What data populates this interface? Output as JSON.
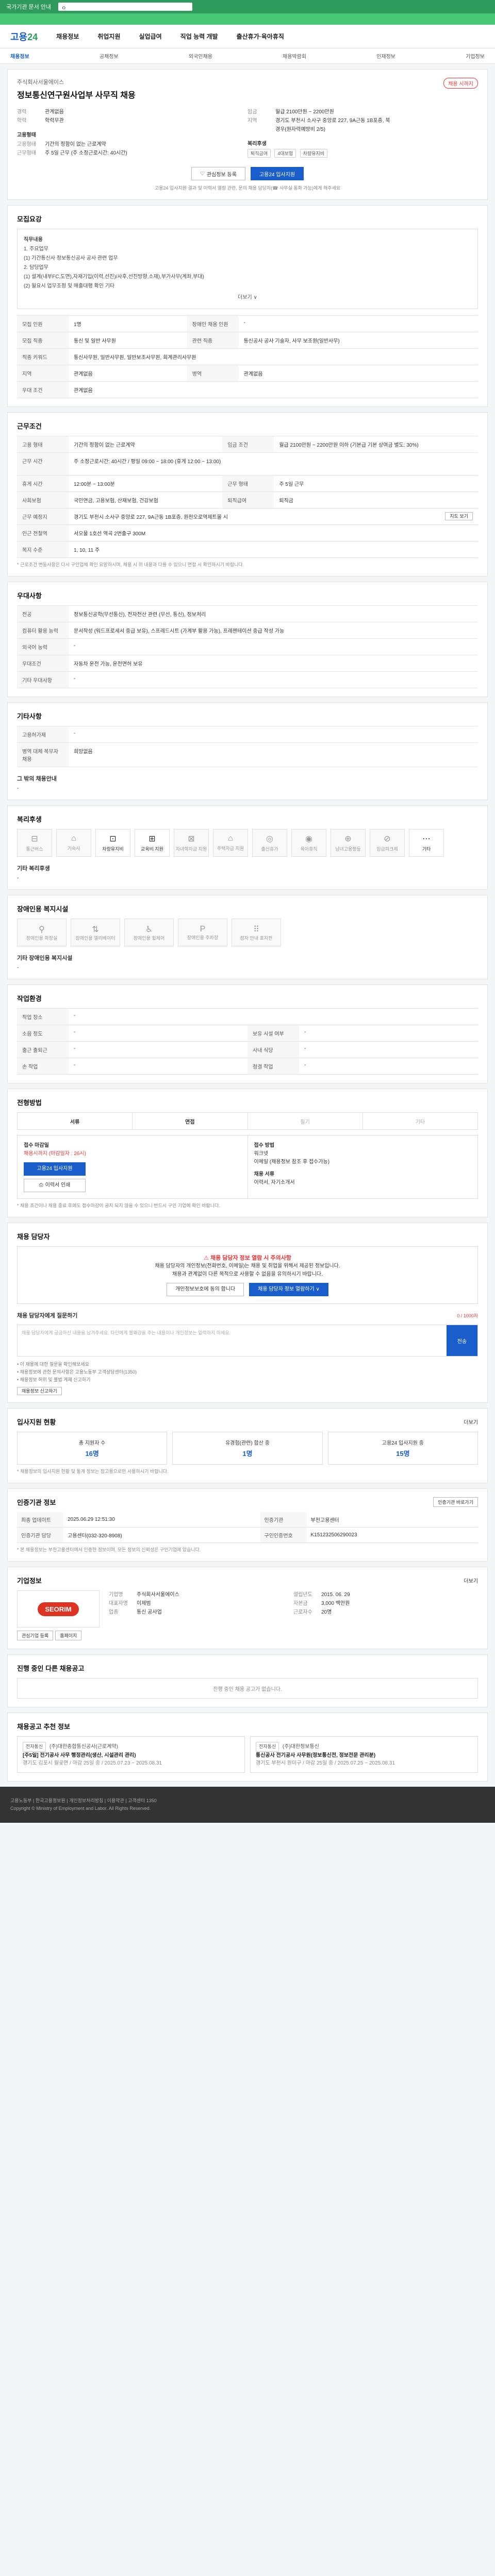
{
  "topbar": {
    "title": "국가기관 문서 안내",
    "search": "ㅇ"
  },
  "greenline": "",
  "gnb": {
    "logo_main": "고용",
    "logo_num": "24",
    "items": [
      "채용정보",
      "취업지원",
      "실업급여",
      "직업 능력 개발",
      "출산휴가·육아휴직"
    ]
  },
  "subnav": [
    "채용정보",
    "공채정보",
    "외국인채용",
    "채용박람회",
    "인재정보",
    "기업정보"
  ],
  "job": {
    "company": "주식회사서울에이스",
    "title": "정보통신연구원사업부 사무직 채용",
    "badge": "채용 시까지",
    "left": [
      {
        "k": "경력",
        "v": "관계없음"
      },
      {
        "k": "학력",
        "v": "학력무관"
      }
    ],
    "right": [
      {
        "k": "임금",
        "v": "월급 2100만원 ~ 2200만원"
      },
      {
        "k": "지역",
        "v": "경기도 부천시 소사구 중앙로 227, 9A근동 1B포층, 북"
      },
      {
        "k": "",
        "v": "경우(원자력예방비 2/5)"
      }
    ],
    "employ_title": "고용형태",
    "employ": [
      {
        "k": "고용형태",
        "v": "기간의 정함이 없는 근로계약"
      },
      {
        "k": "근무형태",
        "v": "주 5일 근무 (주 소정근로시간: 40시간)"
      }
    ],
    "welfare_title": "복리후생",
    "tags": [
      "퇴직금여",
      "4대보험",
      "차량유지비"
    ],
    "btn_save": "관심정보 등록",
    "btn_apply": "고용24 입사지원",
    "note": "고용24 입사지원 결과 및 이력서 열람 관련, 문의 채용 담당자(☎ 사무실 통화 가능)에게 해주세요"
  },
  "recruit": {
    "title": "모집요강",
    "box_lines": [
      "직무내용",
      "1. 주요업무",
      "(1) 기간통신사 정보통신공사 공사 관련 업무",
      "2. 담당업무",
      "(1) 설계(내부FC,도면),자재기입(이력,선진)/사후,선진방향,소재),부가사무(계좌,부대)",
      "(2) 월요시 업무조정 및 매출대행 확인 기타"
    ],
    "more": "더보기 ∨",
    "rows": [
      {
        "h": "모집 인원",
        "v": "1명",
        "h2": "장애인 채용 인원",
        "v2": "-"
      },
      {
        "h": "모집 직종",
        "v": "통신 및 일반 사무원",
        "h2": "관련 직종",
        "v2": "통신공사 공사 기술자, 사무 보조원(일반사무)"
      },
      {
        "h": "직종 키워드",
        "v": "통신사무원, 일반사무원, 일반보조사무원, 회계관리사무원",
        "h2": "",
        "v2": ""
      },
      {
        "h": "지역",
        "v": "관계없음",
        "h2": "병역",
        "v2": "관계없음"
      },
      {
        "h": "우대 조건",
        "v": "관계없음",
        "h2": "",
        "v2": ""
      }
    ]
  },
  "conditions": {
    "title": "근무조건",
    "rows": [
      {
        "h": "고용 형태",
        "v": "기간의 정함이 없는 근로계약",
        "h2": "임금 조건",
        "v2": "월급 2100만원 ~ 2200만원 이하 (기본급 기본 상여금 별도: 30%)"
      },
      {
        "h": "근무 시간",
        "v": "주 소정근로시간: 40시간 / 평일 09:00 ~ 18:00 (휴게 12:00 ~ 13:00)",
        "h2": "",
        "v2": ""
      },
      {
        "h": "휴게 시간",
        "v": "12:00분 ~ 13:00분",
        "h2": "근무 형태",
        "v2": "주 5일 근무"
      },
      {
        "h": "사회보험",
        "v": "국민연금, 고용보험, 산재보험, 건강보험",
        "h2": "퇴직급여",
        "v2": "퇴직금"
      },
      {
        "h": "근무 예정지",
        "v": "경기도 부천시 소사구 중앙로 227, 9A근동 1B포층, 원천오로역제트몰 시",
        "h2": "",
        "v2": ""
      },
      {
        "h": "인근 전철역",
        "v": "서오물 1호선 역곡 2번출구 300M",
        "h2": "",
        "v2": ""
      },
      {
        "h": "복지 수준",
        "v": "1, 10, 11 주",
        "h2": "",
        "v2": ""
      }
    ],
    "note": "* 근로조건 변동사항은 다시 구인업체 확인 요망하시며, 채용 시 위 내용과 다를 수 있으니 면접 시 확인하시기 바랍니다.",
    "btn_map": "지도 보기"
  },
  "prefer": {
    "title": "우대사항",
    "rows": [
      {
        "h": "전공",
        "v": "정보통신공학(무선통신), 전자전산 관련 (무선, 통신), 정보처리"
      },
      {
        "h": "컴퓨터 활용 능력",
        "v": "문서작성 (워드프로세서 중급 보유), 스프레드시트 (가계부 활용 가능), 프레젠테이션 중급 작성 가능"
      },
      {
        "h": "외국어 능력",
        "v": "-"
      },
      {
        "h": "우대조건",
        "v": "자동차 운전 가능, 운전면허 보유"
      },
      {
        "h": "기타 우대사항",
        "v": "-"
      }
    ]
  },
  "etc": {
    "title": "기타사항",
    "rows": [
      {
        "h": "고용허가제",
        "v": "-"
      },
      {
        "h": "병역 대체 복무자 채용",
        "v": "희망없음"
      }
    ],
    "sub": "그 밖의 채용안내",
    "sub_v": "-"
  },
  "welfare": {
    "title": "복리후생",
    "icons": [
      {
        "n": "통근버스",
        "on": false,
        "g": "⊟"
      },
      {
        "n": "기숙사",
        "on": false,
        "g": "⌂"
      },
      {
        "n": "차량유지비",
        "on": true,
        "g": "⊡"
      },
      {
        "n": "교육비 지원",
        "on": true,
        "g": "⊞"
      },
      {
        "n": "자녀학자금 지원",
        "on": false,
        "g": "⊠"
      },
      {
        "n": "주택자금 지원",
        "on": false,
        "g": "⌂"
      },
      {
        "n": "출산휴가",
        "on": false,
        "g": "◎"
      },
      {
        "n": "육아휴직",
        "on": false,
        "g": "◉"
      },
      {
        "n": "남녀고용평등",
        "on": false,
        "g": "⊕"
      },
      {
        "n": "임금피크제",
        "on": false,
        "g": "⊘"
      },
      {
        "n": "기타",
        "on": true,
        "g": "⋯"
      }
    ],
    "sub": "기타 복리후생",
    "sub_v": "-"
  },
  "disability": {
    "title": "장애인용 복지시설",
    "items": [
      "장애인용 화장실",
      "장애인용 엘리베이터",
      "장애인용 휠체어",
      "장애인용 주차장",
      "점자 안내 표지판"
    ],
    "sub": "기타 장애인용 복지시설",
    "sub_v": "-"
  },
  "workenv": {
    "title": "작업환경",
    "rows": [
      {
        "h": "작업 장소",
        "v": "-",
        "h2": "",
        "v2": ""
      },
      {
        "h": "소음 정도",
        "v": "-",
        "h2": "보유 시설 여부",
        "v2": "-"
      },
      {
        "h": "출근 출퇴근",
        "v": "-",
        "h2": "사내 식당",
        "v2": "-"
      },
      {
        "h": "손 작업",
        "v": "-",
        "h2": "청결 작업",
        "v2": "-"
      }
    ]
  },
  "process": {
    "title": "전형방법",
    "steps": [
      "서류",
      "면접",
      "필기",
      "기타"
    ],
    "on": [
      true,
      true,
      false,
      false
    ],
    "apply_col1_title": "접수 마감일",
    "apply_col1_v": "채용시까지 (마감일자 : 26시)",
    "apply_btn": "고용24 입사지원",
    "print_btn": "이력서 인쇄",
    "apply_col2_title": "접수 방법",
    "apply_col2_lines": [
      "워크넷",
      "이메일 (채용정보 참조 후 접수가능)",
      "채용 서류",
      "이력서, 자기소개서"
    ],
    "note": "* 채용 조건이나 채용 종료 후에도 접수마감이 공지 되지 않을 수 있으니 반드시 구인 기업에 확인 바랍니다."
  },
  "contact": {
    "title": "채용 담당자",
    "warn_title": "채용 담당자 정보 열람 시 주의사항",
    "warn_line1": "채용 담당자의 개인정보(전화번호, 이메일)는 채용 및 취업을 위해서 제공된 정보입니다.",
    "warn_line2": "채용과 관계없이 다른 목적으로 사용할 수 없음을 유의하시기 바랍니다.",
    "btn_agree": "개인정보보호에 동의 합니다",
    "btn_view": "채용 담당자 정보 열람하기 ∨",
    "qna_title": "채용 담당자에게 질문하기",
    "qna_count": "0 / 1000자",
    "qna_placeholder": "채용 담당자에게 궁금하신 내용을 남겨주세요. 타인에게 불쾌감을 주는 내용이나 개인정보는 입력하지 마세요.",
    "qna_btn": "전송",
    "notes": [
      "• 이 채용에 대한 질문을 확인해보세요",
      "• 채용정보에 관한 문의사항은 고용노동부 고객상담센터(1350)",
      "• 채용정보 허위 및 불법 게재 신고하기"
    ],
    "report_btn": "채용정보 신고하기"
  },
  "stats": {
    "title": "입사지원 현황",
    "more": "더보기",
    "items": [
      {
        "l": "총 지원자 수",
        "v": "16명"
      },
      {
        "l": "유경험(관련) 합산 중",
        "v": "1명"
      },
      {
        "l": "고용24 입사지원 중",
        "v": "15명"
      }
    ],
    "note": "* 채용정보의 입사지원 현황 및 통계 정보는 참고용으로만 사용하시기 바랍니다."
  },
  "posting": {
    "title": "인증기관 정보",
    "btn": "인증기관 바로가기",
    "rows": [
      {
        "h": "최종 업데이트",
        "v": "2025.06.29 12:51:30",
        "h2": "인증기관",
        "v2": "부천고용센터"
      },
      {
        "h": "인증기관 담당",
        "v": "고용센터(032-320-8908)",
        "h2": "구인인증번호",
        "v2": "K151232506290023"
      }
    ],
    "note": "* 본 채용정보는 부천고용센터에서 인증한 정보이며, 모든 정보의 신뢰성은 구인기업에 있습니다."
  },
  "corp": {
    "title": "기업정보",
    "more": "더보기",
    "logo": "SEORIM",
    "info": [
      {
        "k": "기업명",
        "v": "주식회사서울에이스"
      },
      {
        "k": "설립년도",
        "v": "2015. 06. 29"
      },
      {
        "k": "대표자명",
        "v": "이제범"
      },
      {
        "k": "자본금",
        "v": "3,000 백만원"
      },
      {
        "k": "업종",
        "v": "통신 공사업"
      },
      {
        "k": "근로자수",
        "v": "20명"
      }
    ],
    "btn_like": "관심기업 등록",
    "btn_home": "홈페이지"
  },
  "others": {
    "title": "진행 중인 다른 채용공고",
    "empty": "진행 중인 채용 공고가 없습니다."
  },
  "recommend": {
    "title": "채용공고 추천 정보",
    "cards": [
      {
        "badge": "전자통신",
        "n": "(주)대한종합통신공사(근로계약)",
        "t": "[주5일] 전기공사 사무 행정관리(생산, 시설관리 관리)",
        "d": "경기도 김포시 월곶면 / 마감 25일 중 / 2025.07.23 ~ 2025.08.31"
      },
      {
        "badge": "전자통신",
        "n": "(주)대한정보통신",
        "t": "통신공사 전기공사 사무원(정보통신전, 정보전문 관리분)",
        "d": "경기도 부천시 원미구 / 마감 25일 중 / 2025.07.25 ~ 2025.08.31"
      }
    ]
  },
  "footer": {
    "lines": [
      "고용노동부 | 한국고용정보원 | 개인정보처리방침 | 이용약관 | 고객센터 1350",
      "Copyright © Ministry of Employment and Labor. All Rights Reserved."
    ]
  }
}
